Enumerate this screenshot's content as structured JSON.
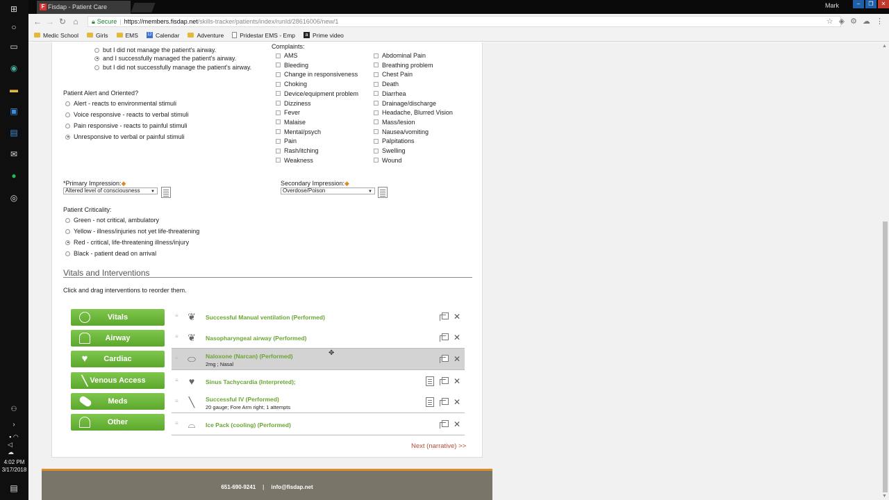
{
  "browser": {
    "tab_title": "Fisdap - Patient Care",
    "tab_favicon": "F",
    "user": "Mark",
    "secure_label": "Secure",
    "url_host": "https://members.fisdap.net",
    "url_path": "/skills-tracker/patients/index/runId/28616006/new/1",
    "bookmarks": [
      "Medic School",
      "Girls",
      "EMS",
      "Calendar",
      "Adventure",
      "Pridestar EMS - Emp",
      "Prime video"
    ]
  },
  "taskbar": {
    "time": "4:02 PM",
    "date": "3/17/2018"
  },
  "airway": {
    "options": [
      {
        "label": "but I did not manage the patient's airway.",
        "selected": false
      },
      {
        "label": "and I successfully managed the patient's airway.",
        "selected": true
      },
      {
        "label": "but I did not successfully manage the patient's airway.",
        "selected": false
      }
    ]
  },
  "alert": {
    "question": "Patient Alert and Oriented?",
    "options": [
      {
        "label": "Alert - reacts to environmental stimuli",
        "selected": false
      },
      {
        "label": "Voice responsive - reacts to verbal stimuli",
        "selected": false
      },
      {
        "label": "Pain responsive - reacts to painful stimuli",
        "selected": false
      },
      {
        "label": "Unresponsive to verbal or painful stimuli",
        "selected": true
      }
    ]
  },
  "complaints": {
    "label": "Complaints:",
    "left": [
      "AMS",
      "Bleeding",
      "Change in responsiveness",
      "Choking",
      "Device/equipment problem",
      "Dizziness",
      "Fever",
      "Malaise",
      "Mental/psych",
      "Pain",
      "Rash/itching",
      "Weakness"
    ],
    "right": [
      "Abdominal Pain",
      "Breathing problem",
      "Chest Pain",
      "Death",
      "Diarrhea",
      "Drainage/discharge",
      "Headache, Blurred Vision",
      "Mass/lesion",
      "Nausea/vomiting",
      "Palpitations",
      "Swelling",
      "Wound"
    ]
  },
  "impressions": {
    "primary_label": "*Primary Impression:",
    "primary_value": "Altered level of consciousness",
    "secondary_label": "Secondary Impression:",
    "secondary_value": "Overdose/Poison"
  },
  "criticality": {
    "label": "Patient Criticality:",
    "options": [
      {
        "label": "Green - not critical, ambulatory",
        "selected": false
      },
      {
        "label": "Yellow - illness/injuries not yet life-threatening",
        "selected": false
      },
      {
        "label": "Red - critical, life-threatening illness/injury",
        "selected": true
      },
      {
        "label": "Black - patient dead on arrival",
        "selected": false
      }
    ]
  },
  "vitals_section": {
    "title": "Vitals and Interventions",
    "instructions": "Click and drag interventions to reorder them.",
    "categories": [
      "Vitals",
      "Airway",
      "Cardiac",
      "Venous Access",
      "Meds",
      "Other"
    ],
    "interventions": [
      {
        "icon": "lungs-icon",
        "title": "Successful Manual ventilation (Performed)",
        "sub": "",
        "note": false
      },
      {
        "icon": "lungs-icon",
        "title": "Nasopharyngeal airway (Performed)",
        "sub": "",
        "note": false
      },
      {
        "icon": "pill-icon",
        "title": "Naloxone (Narcan) (Performed)",
        "sub": "2mg ; Nasal",
        "note": false
      },
      {
        "icon": "heart-icon",
        "title": "Sinus Tachycardia (Interpreted);",
        "sub": "",
        "note": true
      },
      {
        "icon": "needle-icon",
        "title": "Successful IV (Performed)",
        "sub": "20 gauge; Fore Arm right; 1 attempts",
        "note": true
      },
      {
        "icon": "ice-pack-icon",
        "title": "Ice Pack (cooling) (Performed)",
        "sub": "",
        "note": false
      }
    ],
    "next_link": "Next (narrative) >>"
  },
  "footer": {
    "phone": "651-690-9241",
    "separator": "|",
    "email": "info@fisdap.net"
  },
  "colors": {
    "accent_green": "#6aa533",
    "button_green": "#5ba82c",
    "link_red": "#b14d32",
    "footer_bg": "#7a7569",
    "footer_accent": "#e08a2a"
  }
}
